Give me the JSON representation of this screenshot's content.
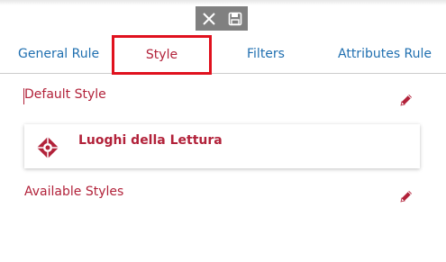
{
  "toolbar": {
    "close_icon": "close-icon",
    "save_icon": "save-icon"
  },
  "tabs": [
    {
      "label": "General Rule",
      "active": false
    },
    {
      "label": "Style",
      "active": true
    },
    {
      "label": "Filters",
      "active": false
    },
    {
      "label": "Attributes Rule",
      "active": false
    }
  ],
  "default_style": {
    "label": "Default Style",
    "edit_icon": "pencil-icon",
    "item": {
      "name": "Luoghi della Lettura",
      "icon": "style-symbol-icon"
    }
  },
  "available_styles": {
    "label": "Available Styles",
    "edit_icon": "pencil-icon"
  },
  "colors": {
    "accent": "#b2223a",
    "tab_link": "#1f6fb0",
    "highlight_box": "#e0111e",
    "toolbar_bg": "#808080"
  }
}
